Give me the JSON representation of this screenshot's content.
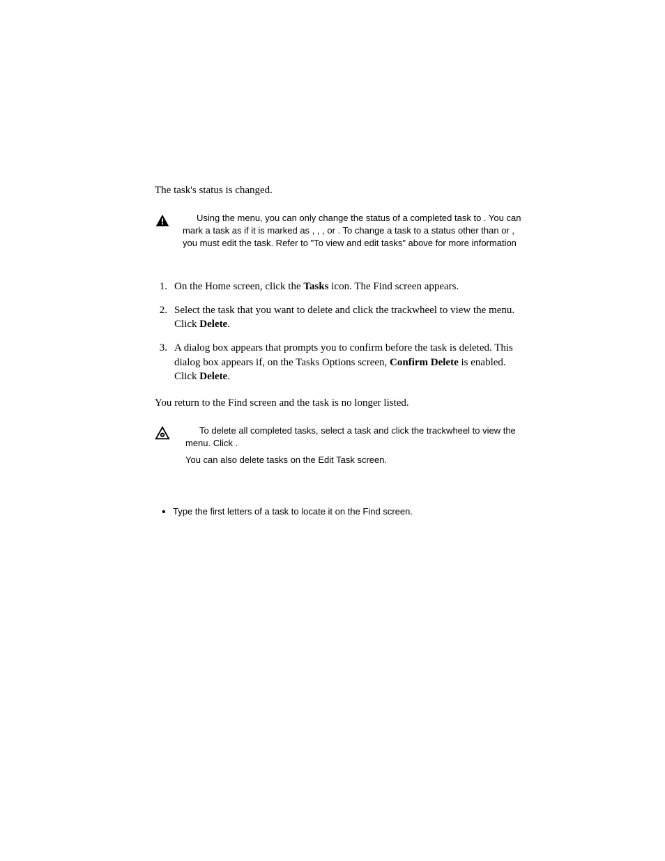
{
  "statusLine": "The task's status is changed.",
  "note": {
    "line1a": "Using the menu, you can only change the status of a completed task to ",
    "line1b": ". You can mark a task as ",
    "line1c": " if it is marked as ",
    "line1d": ", ",
    "line1e": ", ",
    "line1f": ", or ",
    "line1g": ". To change a task to a status other than ",
    "line1h": " or ",
    "line1i": ", you must edit the task. Refer to \"To view and edit tasks\" above for more information"
  },
  "steps": {
    "n1": "1.",
    "n2": "2.",
    "n3": "3.",
    "s1a": "On the Home screen, click the ",
    "s1b": "Tasks",
    "s1c": " icon. The Find screen appears.",
    "s2a": "Select the task that you want to delete and click the trackwheel to view the menu. Click ",
    "s2b": "Delete",
    "s2c": ".",
    "s3a": "A dialog box appears that prompts you to confirm before the task is deleted. This dialog box appears if, on the Tasks Options screen, ",
    "s3b": "Confirm Delete",
    "s3c": " is enabled. Click ",
    "s3d": "Delete",
    "s3e": "."
  },
  "returnLine": "You return to the Find screen and the task is no longer listed.",
  "tip": {
    "p1a": "To delete all completed tasks, select a task and click the trackwheel to view the menu. Click ",
    "p1b": ".",
    "p2": "You can also delete tasks on the Edit Task screen."
  },
  "bullet": "Type the first letters of a task to locate it on the Find screen."
}
